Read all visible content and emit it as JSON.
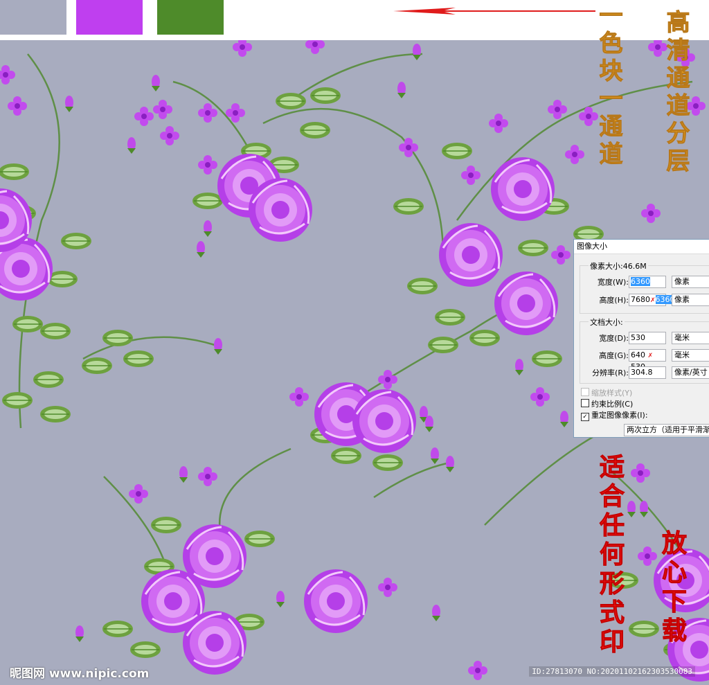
{
  "colors": {
    "background": "#a8acbf",
    "purple": "#bf3fef",
    "green": "#4e8b2a",
    "arrow": "#e01b1b"
  },
  "swatches": [
    "#a8acbf",
    "#bf3fef",
    "#4e8b2a"
  ],
  "text_overlays": {
    "channel_note": "一色块一通道",
    "hd_note": "高清通道分层",
    "print_note": "适合任何形式印",
    "download_note": "放心下载"
  },
  "dialog": {
    "title": "图像大小",
    "pixel_dimensions": {
      "label": "像素大小:46.6M",
      "width_label": "宽度(W):",
      "width_value": "6360",
      "width_unit": "像素",
      "height_label": "高度(H):",
      "height_value_old": "7680",
      "height_value_new": "6360",
      "height_unit": "像素"
    },
    "document_size": {
      "label": "文档大小:",
      "width_label": "宽度(D):",
      "width_value": "530",
      "width_unit": "毫米",
      "height_label": "高度(G):",
      "height_value_old": "640",
      "height_value_new": "530",
      "height_unit": "毫米",
      "resolution_label": "分辨率(R):",
      "resolution_value": "304.8",
      "resolution_unit": "像素/英寸"
    },
    "scale_styles": "缩放样式(Y)",
    "constrain": "约束比例(C)",
    "resample": "重定图像像素(I):",
    "resample_method": "两次立方（适用于平滑渐变"
  },
  "watermark": {
    "site": "昵图网 www.nipic.com",
    "id": "ID:27813070 NO:20201102162303530083"
  }
}
